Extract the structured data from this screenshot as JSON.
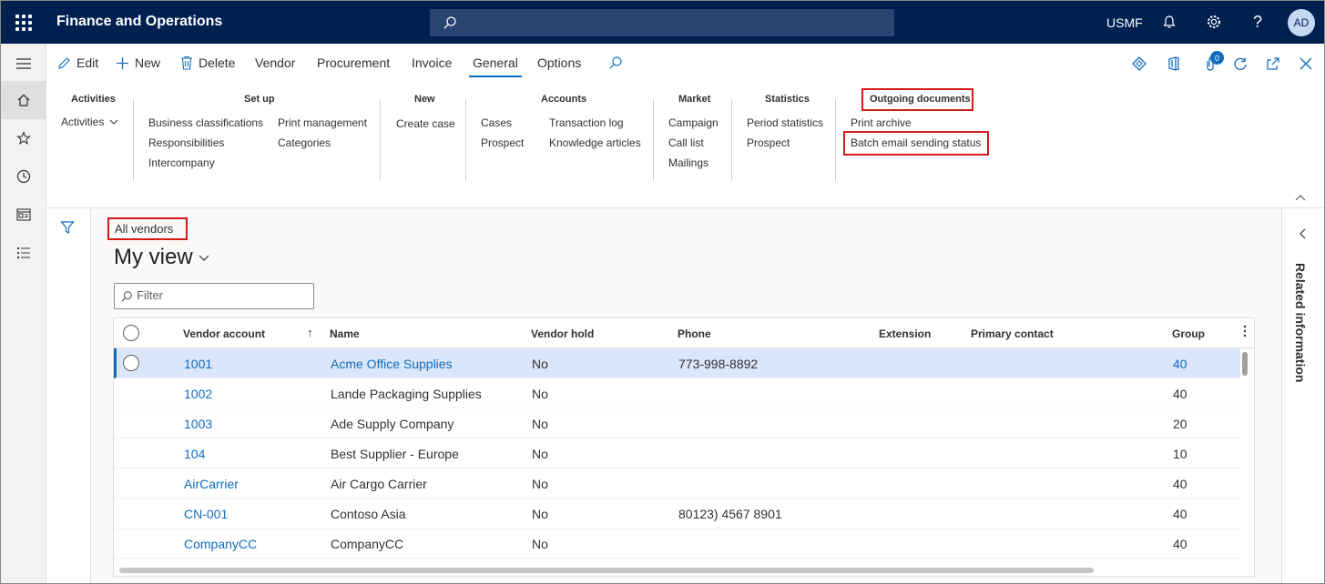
{
  "topbar": {
    "app_title": "Finance and Operations",
    "company": "USMF",
    "avatar_initials": "AD",
    "background": "#002050"
  },
  "actionbar": {
    "edit": "Edit",
    "new": "New",
    "delete": "Delete",
    "tabs": [
      "Vendor",
      "Procurement",
      "Invoice",
      "General",
      "Options"
    ],
    "active_tab": "General",
    "notification_count": "0"
  },
  "ribbon": {
    "groups": {
      "activities": {
        "title": "Activities",
        "items": [
          "Activities"
        ]
      },
      "setup": {
        "title": "Set up",
        "items": [
          "Business classifications",
          "Responsibilities",
          "Intercompany",
          "Print management",
          "Categories"
        ]
      },
      "new": {
        "title": "New",
        "items": [
          "Create case"
        ]
      },
      "accounts": {
        "title": "Accounts",
        "items": [
          "Cases",
          "Prospect",
          "Transaction log",
          "Knowledge articles"
        ]
      },
      "market": {
        "title": "Market",
        "items": [
          "Campaign",
          "Call list",
          "Mailings"
        ]
      },
      "statistics": {
        "title": "Statistics",
        "items": [
          "Period statistics",
          "Prospect"
        ]
      },
      "outgoing": {
        "title": "Outgoing documents",
        "items": [
          "Print archive",
          "Batch email sending status"
        ]
      }
    },
    "highlight_color": "#d21a1a"
  },
  "content": {
    "breadcrumb": "All vendors",
    "view_title": "My view",
    "filter_placeholder": "Filter"
  },
  "grid": {
    "columns": [
      "Vendor account",
      "Name",
      "Vendor hold",
      "Phone",
      "Extension",
      "Primary contact",
      "Group"
    ],
    "sorted_column": "Vendor account",
    "rows": [
      {
        "account": "1001",
        "name": "Acme Office Supplies",
        "hold": "No",
        "phone": "773-998-8892",
        "extension": "",
        "contact": "",
        "group": "40",
        "selected": true
      },
      {
        "account": "1002",
        "name": "Lande Packaging Supplies",
        "hold": "No",
        "phone": "",
        "extension": "",
        "contact": "",
        "group": "40"
      },
      {
        "account": "1003",
        "name": "Ade Supply Company",
        "hold": "No",
        "phone": "",
        "extension": "",
        "contact": "",
        "group": "20"
      },
      {
        "account": "104",
        "name": "Best Supplier - Europe",
        "hold": "No",
        "phone": "",
        "extension": "",
        "contact": "",
        "group": "10"
      },
      {
        "account": "AirCarrier",
        "name": "Air Cargo Carrier",
        "hold": "No",
        "phone": "",
        "extension": "",
        "contact": "",
        "group": "40"
      },
      {
        "account": "CN-001",
        "name": "Contoso Asia",
        "hold": "No",
        "phone": "80123) 4567 8901",
        "extension": "",
        "contact": "",
        "group": "40"
      },
      {
        "account": "CompanyCC",
        "name": "CompanyCC",
        "hold": "No",
        "phone": "",
        "extension": "",
        "contact": "",
        "group": "40"
      }
    ]
  },
  "related": {
    "label": "Related information"
  },
  "icons": [
    "waffle-icon",
    "search-icon",
    "bell-icon",
    "gear-icon",
    "help-icon",
    "hamburger-icon",
    "home-icon",
    "star-icon",
    "clock-icon",
    "workspace-icon",
    "list-icon",
    "filter-icon",
    "chevron-down-icon",
    "chevron-left-icon",
    "chevron-up-icon"
  ]
}
